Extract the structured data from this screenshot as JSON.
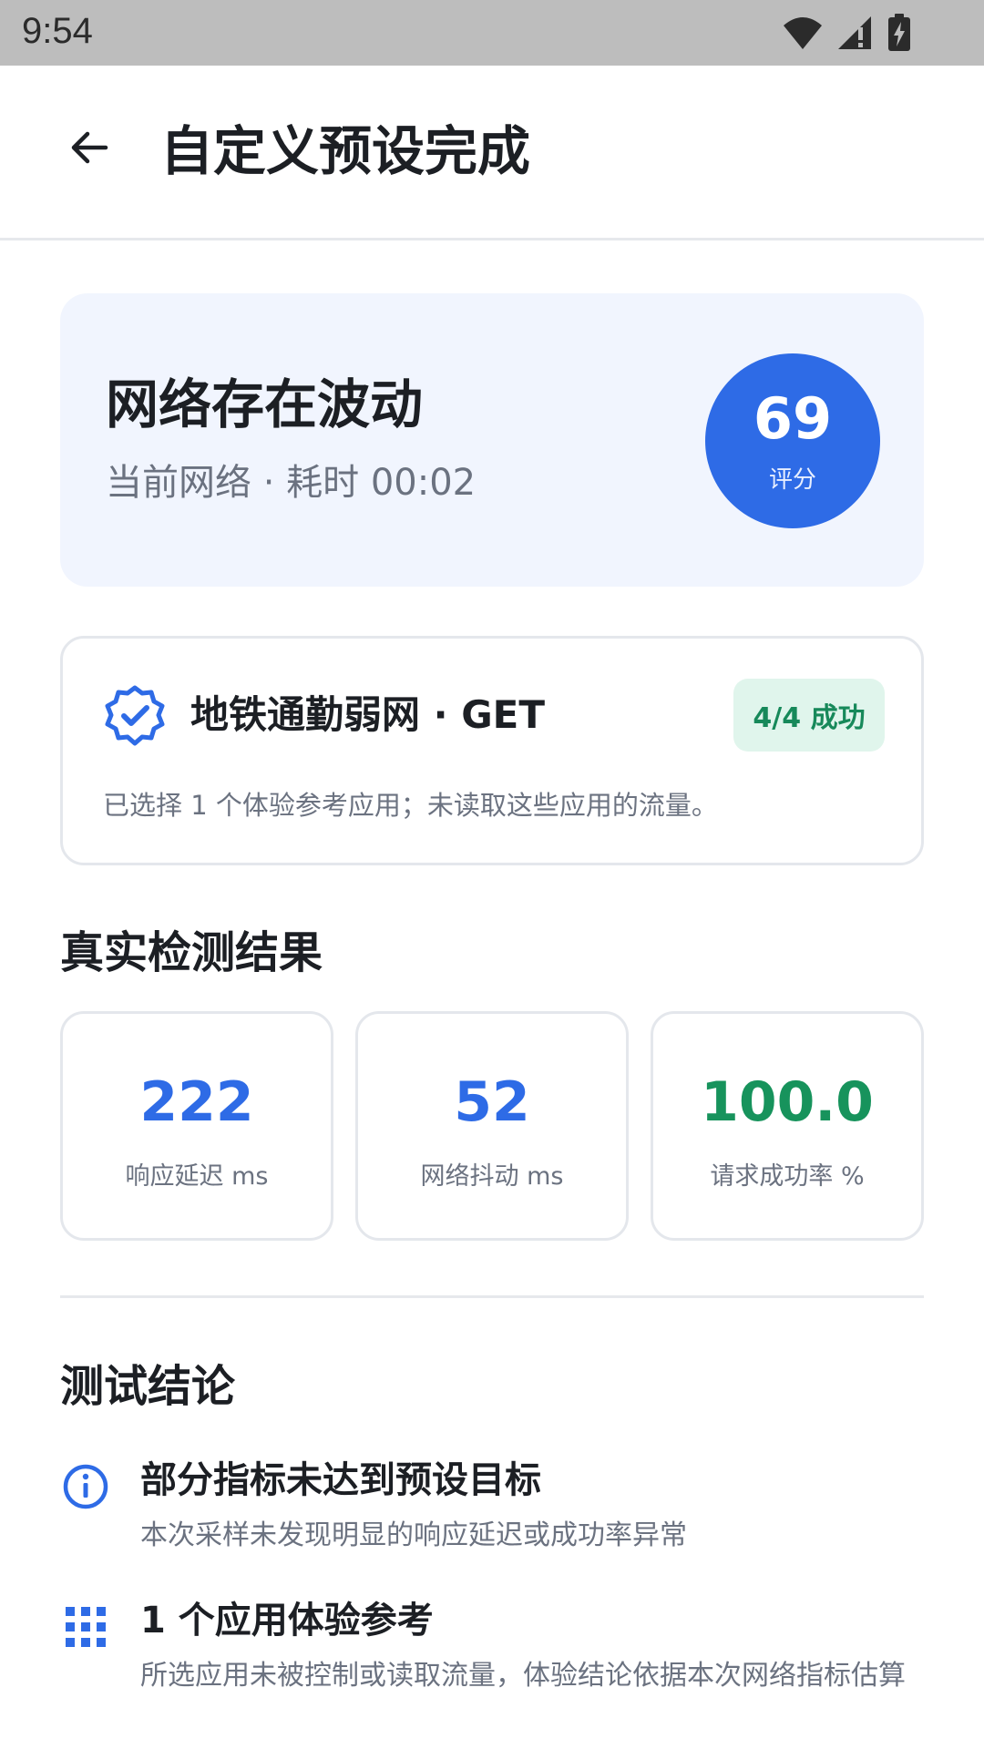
{
  "status_bar": {
    "time": "9:54",
    "icons": [
      "wifi-icon",
      "signal-icon",
      "battery-charging-icon"
    ]
  },
  "app_bar": {
    "back_icon": "arrow-left-icon",
    "title": "自定义预设完成"
  },
  "summary": {
    "title": "网络存在波动",
    "subtitle": "当前网络 · 耗时 00:02",
    "score": 69,
    "score_label": "评分"
  },
  "preset": {
    "icon": "verified-badge-icon",
    "title": "地铁通勤弱网 · GET",
    "badge": "4/4 成功",
    "description": "已选择 1 个体验参考应用；未读取这些应用的流量。"
  },
  "results": {
    "section_title": "真实检测结果",
    "metrics": [
      {
        "value": "222",
        "label": "响应延迟 ms",
        "color": "#2e6be6"
      },
      {
        "value": "52",
        "label": "网络抖动 ms",
        "color": "#2e6be6"
      },
      {
        "value": "100.0",
        "label": "请求成功率 %",
        "color": "#17935c"
      }
    ]
  },
  "conclusion": {
    "section_title": "测试结论",
    "items": [
      {
        "icon": "info-icon",
        "title": "部分指标未达到预设目标",
        "description": "本次采样未发现明显的响应延迟或成功率异常"
      },
      {
        "icon": "apps-grid-icon",
        "title": "1 个应用体验参考",
        "description": "所选应用未被控制或读取流量，体验结论依据本次网络指标估算"
      }
    ]
  },
  "colors": {
    "accent": "#2e6be6",
    "success": "#17935c",
    "hero_background": "#f1f5fe"
  }
}
